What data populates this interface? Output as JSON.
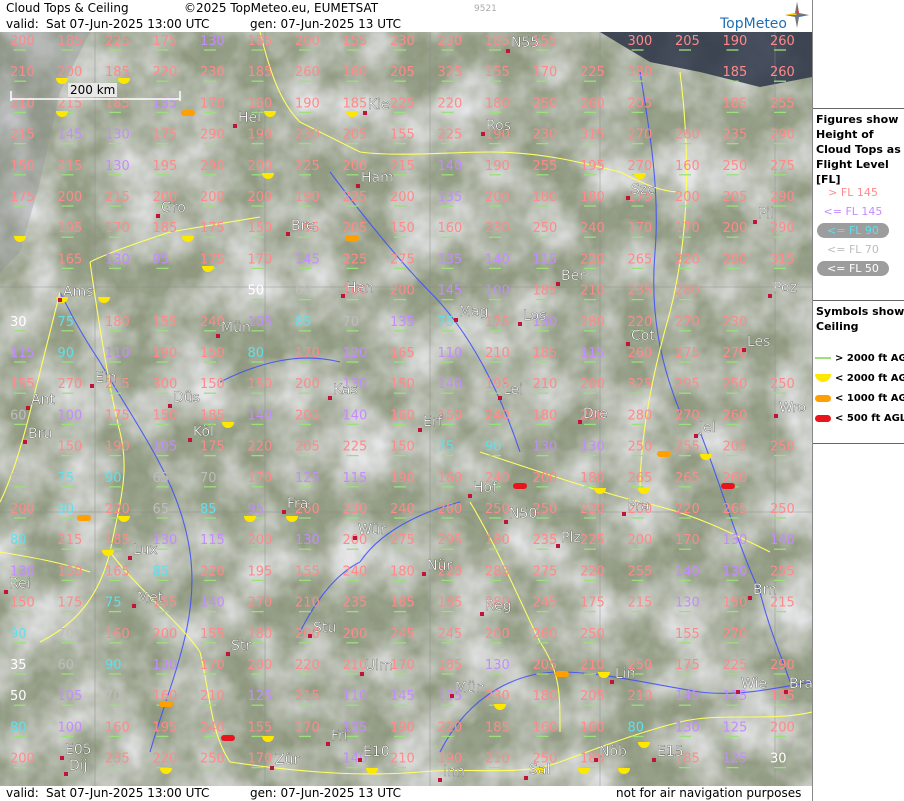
{
  "header": {
    "title": "Cloud Tops & Ceiling",
    "copyright": "©2025 TopMeteo.eu, EUMETSAT",
    "valid_label": "valid:",
    "valid_value": "Sat   07-Jun-2025  13:00 UTC",
    "gen_value": "gen: 07-Jun-2025 13 UTC",
    "code": "9521",
    "logo": "TopMeteo"
  },
  "footer": {
    "valid_label": "valid:",
    "valid_value": "Sat   07-Jun-2025  13:00 UTC",
    "gen_value": "gen: 07-Jun-2025 13 UTC",
    "disclaimer": "not for air navigation purposes"
  },
  "scale": {
    "label": "200 km"
  },
  "legend": {
    "heights_title": "Figures show Height of Cloud Tops as Flight Level  [FL]",
    "heights": [
      {
        "label": "> FL 145",
        "color": "#ff8a8a"
      },
      {
        "label": "<= FL 145",
        "color": "#c58bff"
      },
      {
        "label": "<= FL 90",
        "color": "#5fe0ee"
      },
      {
        "label": "<= FL 70",
        "color": "#bdbdbd"
      },
      {
        "label": "<= FL 50",
        "color": "#ffffff"
      }
    ],
    "symbols_title": "Symbols show Ceiling",
    "symbols": [
      {
        "label": "> 2000 ft AGL",
        "color": "#9be07a",
        "icon": "line"
      },
      {
        "label": "< 2000 ft AGL",
        "color": "#ffe800",
        "icon": "half-disc"
      },
      {
        "label": "< 1000 ft AGL",
        "color": "#ff9f00",
        "icon": "bar"
      },
      {
        "label": "< 500 ft AGL",
        "color": "#e8141e",
        "icon": "bar"
      }
    ]
  },
  "colors": {
    "high": "#ff8a8a",
    "mid": "#c58bff",
    "low90": "#5fe0ee",
    "low70": "#bdbdbd",
    "low50": "#ffffff",
    "land": "#5b6b44",
    "cloud": "#c8c8c8",
    "river": "#3b4cff",
    "border": "#ffff60"
  },
  "cities": [
    {
      "name": "Kie",
      "color": "#ffffff"
    },
    {
      "name": "Hel",
      "color": "#ffffff"
    },
    {
      "name": "Ros",
      "color": "#ffffff"
    },
    {
      "name": "Ham",
      "color": "#ffffff"
    },
    {
      "name": "Szc",
      "color": "#ffffff"
    },
    {
      "name": "Gro",
      "color": "#ffffff"
    },
    {
      "name": "Bre",
      "color": "#ffffff"
    },
    {
      "name": "Pil",
      "color": "#ffffff"
    },
    {
      "name": "Ber",
      "color": "#ffffff"
    },
    {
      "name": "Ams",
      "color": "#ffffff"
    },
    {
      "name": "Han",
      "color": "#ffffff"
    },
    {
      "name": "Poz",
      "color": "#ffffff"
    },
    {
      "name": "Mün",
      "color": "#ffffff"
    },
    {
      "name": "Mag",
      "color": "#ffffff"
    },
    {
      "name": "Los",
      "color": "#ffffff"
    },
    {
      "name": "Cot",
      "color": "#ffffff"
    },
    {
      "name": "Les",
      "color": "#ffffff"
    },
    {
      "name": "Ein",
      "color": "#ffffff"
    },
    {
      "name": "Kas",
      "color": "#ffffff"
    },
    {
      "name": "Lei",
      "color": "#ffffff"
    },
    {
      "name": "Ant",
      "color": "#ffffff"
    },
    {
      "name": "Düs",
      "color": "#ffffff"
    },
    {
      "name": "Dre",
      "color": "#ffffff"
    },
    {
      "name": "Wro",
      "color": "#ffffff"
    },
    {
      "name": "Bru",
      "color": "#ffffff"
    },
    {
      "name": "Köl",
      "color": "#ffffff"
    },
    {
      "name": "Erf",
      "color": "#ffffff"
    },
    {
      "name": "Jel",
      "color": "#ffffff"
    },
    {
      "name": "Hof",
      "color": "#ffffff"
    },
    {
      "name": "Fra",
      "color": "#ffffff"
    },
    {
      "name": "Pra",
      "color": "#ffffff"
    },
    {
      "name": "N50",
      "color": "#ffffff"
    },
    {
      "name": "Lux",
      "color": "#ffffff"
    },
    {
      "name": "Wür",
      "color": "#ffffff"
    },
    {
      "name": "Plz",
      "color": "#ffffff"
    },
    {
      "name": "Nür",
      "color": "#ffffff"
    },
    {
      "name": "Rei",
      "color": "#ffffff"
    },
    {
      "name": "Met",
      "color": "#ffffff"
    },
    {
      "name": "Brn",
      "color": "#ffffff"
    },
    {
      "name": "Reg",
      "color": "#ffffff"
    },
    {
      "name": "Stu",
      "color": "#ffffff"
    },
    {
      "name": "Str",
      "color": "#ffffff"
    },
    {
      "name": "Ulm",
      "color": "#ffffff"
    },
    {
      "name": "Lin",
      "color": "#ffffff"
    },
    {
      "name": "Mün",
      "color": "#ffffff"
    },
    {
      "name": "Wie",
      "color": "#ffffff"
    },
    {
      "name": "Bra",
      "color": "#ffffff"
    },
    {
      "name": "Fri",
      "color": "#ffffff"
    },
    {
      "name": "E05",
      "color": "#ffffff"
    },
    {
      "name": "Dij",
      "color": "#ffffff"
    },
    {
      "name": "Zür",
      "color": "#ffffff"
    },
    {
      "name": "E10",
      "color": "#ffffff"
    },
    {
      "name": "Inn",
      "color": "#ffffff"
    },
    {
      "name": "Sal",
      "color": "#ffffff"
    },
    {
      "name": "Nöb",
      "color": "#ffffff"
    },
    {
      "name": "E15",
      "color": "#ffffff"
    },
    {
      "name": "N55",
      "color": "#ffffff"
    }
  ],
  "grid_values": [
    [
      "200",
      "185",
      "225",
      "175",
      "130",
      "185",
      "200",
      "155",
      "230",
      "230",
      "185",
      "155",
      "",
      "300",
      "205",
      "190",
      "260"
    ],
    [
      "210",
      "200",
      "185",
      "220",
      "230",
      "185",
      "260",
      "160",
      "205",
      "325",
      "155",
      "170",
      "225",
      "180",
      "",
      "185",
      "260"
    ],
    [
      "210",
      "215",
      "185",
      "135",
      "170",
      "160",
      "190",
      "185",
      "225",
      "220",
      "180",
      "250",
      "260",
      "205",
      "",
      "185",
      "255"
    ],
    [
      "215",
      "145",
      "130",
      "175",
      "290",
      "190",
      "230",
      "205",
      "155",
      "225",
      "190",
      "230",
      "315",
      "270",
      "260",
      "235",
      "290"
    ],
    [
      "150",
      "215",
      "130",
      "195",
      "290",
      "200",
      "225",
      "200",
      "215",
      "140",
      "190",
      "255",
      "195",
      "270",
      "160",
      "250",
      "275"
    ],
    [
      "175",
      "200",
      "215",
      "200",
      "200",
      "200",
      "190",
      "225",
      "200",
      "135",
      "200",
      "180",
      "180",
      "175",
      "200",
      "205",
      "290"
    ],
    [
      "",
      "195",
      "170",
      "185",
      "175",
      "150",
      "195",
      "205",
      "150",
      "160",
      "230",
      "250",
      "240",
      "170",
      "170",
      "200",
      "290"
    ],
    [
      "",
      "165",
      "130",
      "95",
      "175",
      "170",
      "145",
      "225",
      "275",
      "135",
      "140",
      "115",
      "220",
      "265",
      "220",
      "290",
      "315"
    ],
    [
      "",
      "",
      "",
      "",
      "",
      "50",
      "60",
      "160",
      "200",
      "145",
      "100",
      "185",
      "210",
      "235",
      "280",
      "",
      "",
      ""
    ],
    [
      "30",
      "75",
      "180",
      "155",
      "240",
      "105",
      "85",
      "70",
      "135",
      "75",
      "175",
      "130",
      "280",
      "220",
      "270",
      "230",
      ""
    ],
    [
      "115",
      "90",
      "110",
      "190",
      "150",
      "80",
      "170",
      "120",
      "165",
      "110",
      "210",
      "185",
      "115",
      "260",
      "275",
      "270",
      ""
    ],
    [
      "155",
      "270",
      "215",
      "300",
      "150",
      "150",
      "200",
      "130",
      "150",
      "140",
      "195",
      "210",
      "200",
      "325",
      "295",
      "250",
      "250"
    ],
    [
      "60",
      "100",
      "175",
      "150",
      "185",
      "140",
      "205",
      "140",
      "160",
      "150",
      "240",
      "180",
      "200",
      "280",
      "270",
      "260",
      ""
    ],
    [
      "",
      "150",
      "190",
      "105",
      "175",
      "220",
      "205",
      "225",
      "150",
      "75",
      "90",
      "130",
      "130",
      "250",
      "255",
      "205",
      "250"
    ],
    [
      "65",
      "75",
      "90",
      "65",
      "70",
      "170",
      "125",
      "115",
      "190",
      "160",
      "240",
      "200",
      "180",
      "265",
      "265",
      "260",
      ""
    ],
    [
      "200",
      "90",
      "220",
      "65",
      "85",
      "95",
      "260",
      "230",
      "240",
      "260",
      "250",
      "250",
      "220",
      "200",
      "220",
      "265",
      "250"
    ],
    [
      "80",
      "215",
      "185",
      "130",
      "115",
      "200",
      "130",
      "200",
      "275",
      "295",
      "180",
      "235",
      "225",
      "200",
      "170",
      "130",
      "140"
    ],
    [
      "130",
      "150",
      "165",
      "85",
      "220",
      "195",
      "155",
      "240",
      "180",
      "220",
      "285",
      "275",
      "220",
      "255",
      "140",
      "130",
      "255"
    ],
    [
      "150",
      "175",
      "75",
      "155",
      "140",
      "270",
      "210",
      "235",
      "185",
      "185",
      "280",
      "245",
      "175",
      "215",
      "130",
      "150",
      "215"
    ],
    [
      "90",
      "70",
      "160",
      "200",
      "155",
      "180",
      "200",
      "200",
      "245",
      "245",
      "200",
      "260",
      "250",
      "",
      "155",
      "270",
      ""
    ],
    [
      "35",
      "60",
      "90",
      "130",
      "170",
      "200",
      "220",
      "210",
      "170",
      "185",
      "130",
      "205",
      "210",
      "250",
      "175",
      "225",
      "290"
    ],
    [
      "50",
      "105",
      "70",
      "160",
      "210",
      "125",
      "215",
      "110",
      "145",
      "135",
      "230",
      "180",
      "205",
      "210",
      "145",
      "125",
      "185"
    ],
    [
      "80",
      "100",
      "160",
      "195",
      "240",
      "155",
      "170",
      "135",
      "190",
      "220",
      "185",
      "160",
      "160",
      "80",
      "130",
      "125",
      "200"
    ],
    [
      "200",
      "",
      "235",
      "220",
      "250",
      "170",
      "",
      "140",
      "210",
      "190",
      "210",
      "250",
      "180",
      "",
      "185",
      "125",
      "30"
    ]
  ]
}
